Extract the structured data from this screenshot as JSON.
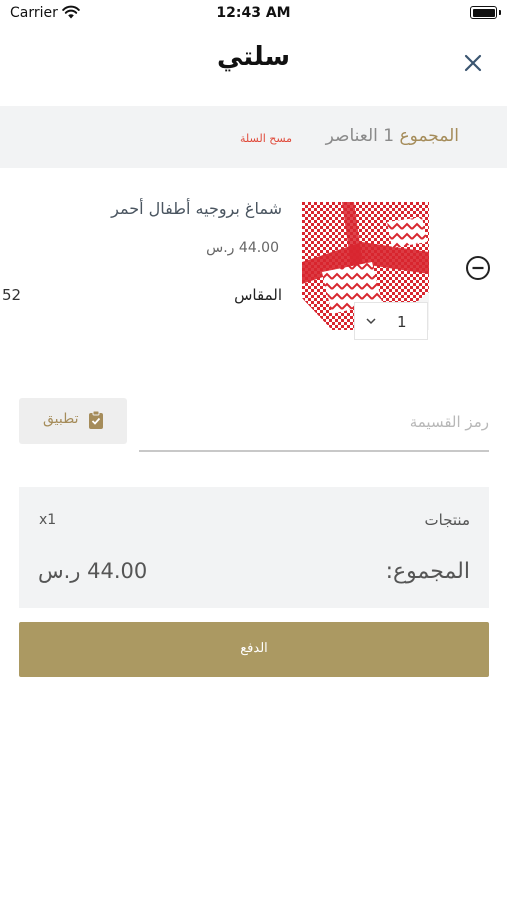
{
  "status_bar": {
    "carrier": "Carrier",
    "time": "12:43 AM"
  },
  "header": {
    "title": "سلتي",
    "close_icon": "close-icon"
  },
  "summary": {
    "total_label": "المجموع",
    "item_count": "1",
    "items_word": "العناصر",
    "clear_cart": "مسح السلة"
  },
  "cart_items": [
    {
      "name": "شماغ بروجيه أطفال أحمر",
      "price": "44.00 ر.س",
      "size_label": "المقاس",
      "size_value": "52",
      "quantity": "1",
      "image_colors": {
        "pattern": "#d8262f",
        "base": "#ffffff"
      }
    }
  ],
  "coupon": {
    "placeholder": "رمز القسيمة",
    "value": "",
    "apply_label": "تطبيق"
  },
  "order_summary": {
    "items_label": "منتجات",
    "items_count": "x1",
    "total_label": "المجموع:",
    "total_value": "44.00 ر.س"
  },
  "checkout": {
    "label": "الدفع"
  },
  "colors": {
    "accent": "#ab9962",
    "gold_text": "#a58c5a",
    "danger": "#e04a3a",
    "panel_bg": "#f2f3f4"
  }
}
